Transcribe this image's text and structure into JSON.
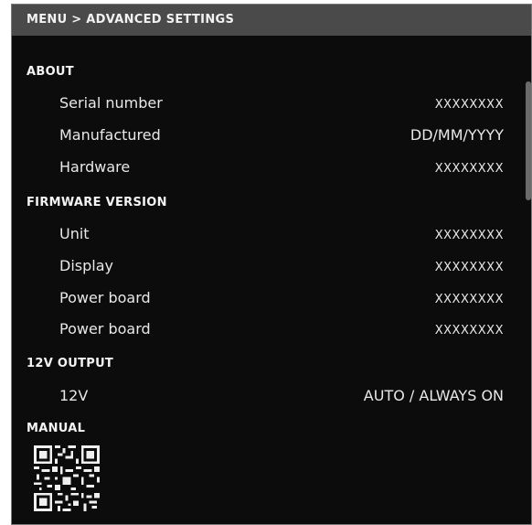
{
  "header": {
    "title": "MENU > ADVANCED SETTINGS"
  },
  "sections": [
    {
      "title": "ABOUT",
      "rows": [
        {
          "label": "Serial number",
          "value": "XXXXXXXX"
        },
        {
          "label": "Manufactured",
          "value": "DD/MM/YYYY"
        },
        {
          "label": "Hardware",
          "value": "XXXXXXXX"
        }
      ]
    },
    {
      "title": "FIRMWARE VERSION",
      "rows": [
        {
          "label": "Unit",
          "value": "XXXXXXXX"
        },
        {
          "label": "Display",
          "value": "XXXXXXXX"
        },
        {
          "label": "Power board",
          "value": "XXXXXXXX"
        },
        {
          "label": "Power board",
          "value": "XXXXXXXX"
        }
      ]
    },
    {
      "title": "12V OUTPUT",
      "rows": [
        {
          "label": "12V",
          "value": "AUTO / ALWAYS ON"
        }
      ]
    },
    {
      "title": "MANUAL",
      "rows": []
    }
  ],
  "manual": {
    "qr_icon": "qr-code-icon"
  },
  "colors": {
    "background": "#0c0c0c",
    "header_bg": "#4a4a4a",
    "text": "#eeeeee"
  }
}
